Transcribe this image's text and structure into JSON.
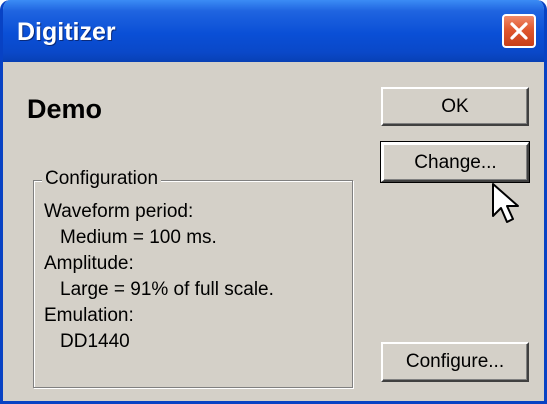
{
  "window": {
    "title": "Digitizer",
    "close_icon": "close-icon",
    "accent": "#0a4fd6",
    "close_color": "#e0572e"
  },
  "heading": "Demo",
  "configuration": {
    "legend": "Configuration",
    "waveform_label": "Waveform period:",
    "waveform_value": "Medium = 100 ms.",
    "amplitude_label": "Amplitude:",
    "amplitude_value": "Large = 91% of full scale.",
    "emulation_label": "Emulation:",
    "emulation_value": "DD1440"
  },
  "buttons": {
    "ok": "OK",
    "change": "Change...",
    "configure": "Configure..."
  },
  "cursor_icon": "mouse-pointer-icon"
}
